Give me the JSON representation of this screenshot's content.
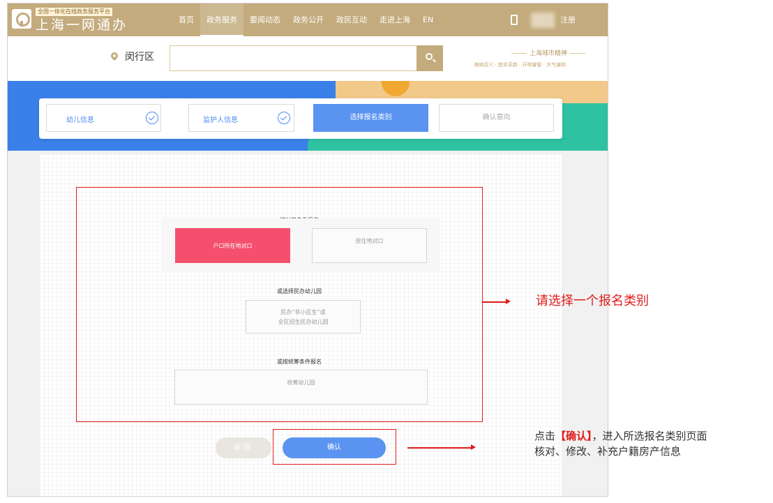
{
  "header": {
    "logo_tagline": "全国一体化在线政务服务平台",
    "logo_name": "上海一网通办",
    "nav": [
      "首页",
      "政务服务",
      "要闻动态",
      "政务公开",
      "政民互动",
      "走进上海",
      "EN"
    ],
    "nav_active_index": 1,
    "register": "注册"
  },
  "search": {
    "district": "闵行区",
    "placeholder": "",
    "slogan_title": "上海城市精神",
    "slogan_sub": "海纳百川 · 追求卓越 · 开明睿智 · 大气谦和"
  },
  "steps": [
    {
      "label": "幼儿信息",
      "state": "done"
    },
    {
      "label": "监护人信息",
      "state": "done"
    },
    {
      "label": "选择报名类别",
      "state": "current"
    },
    {
      "label": "确认意向",
      "state": "todo"
    }
  ],
  "sections": {
    "s1_title": "按对口条件报名",
    "s1_opt1": "户口所在地对口",
    "s1_opt2": "居住地对口",
    "s2_title": "或选择民办幼儿园",
    "s2_opt_line1": "民办“非小区生”或",
    "s2_opt_line2": "全区招生民办幼儿园",
    "s3_title": "或按统筹条件报名",
    "s3_opt": "统筹幼儿园",
    "selected_option": "户口所在地对口"
  },
  "buttons": {
    "back": "返回",
    "confirm": "确认"
  },
  "annotations": {
    "choose_hint": "请选择一个报名类别",
    "click_prefix": "点击",
    "click_highlight": "【确认】",
    "click_rest": "，进入所选报名类别页面",
    "click_line2": "核对、修改、补充户籍房产信息"
  },
  "colors": {
    "brand_gold": "#c3ab7d",
    "step_blue": "#5a94f0",
    "selected_pink": "#f4506e",
    "annotation_red": "#e11b1b"
  },
  "icons": [
    "logo-icon",
    "mobile-icon",
    "location-pin-icon",
    "search-icon",
    "check-circle-icon"
  ]
}
